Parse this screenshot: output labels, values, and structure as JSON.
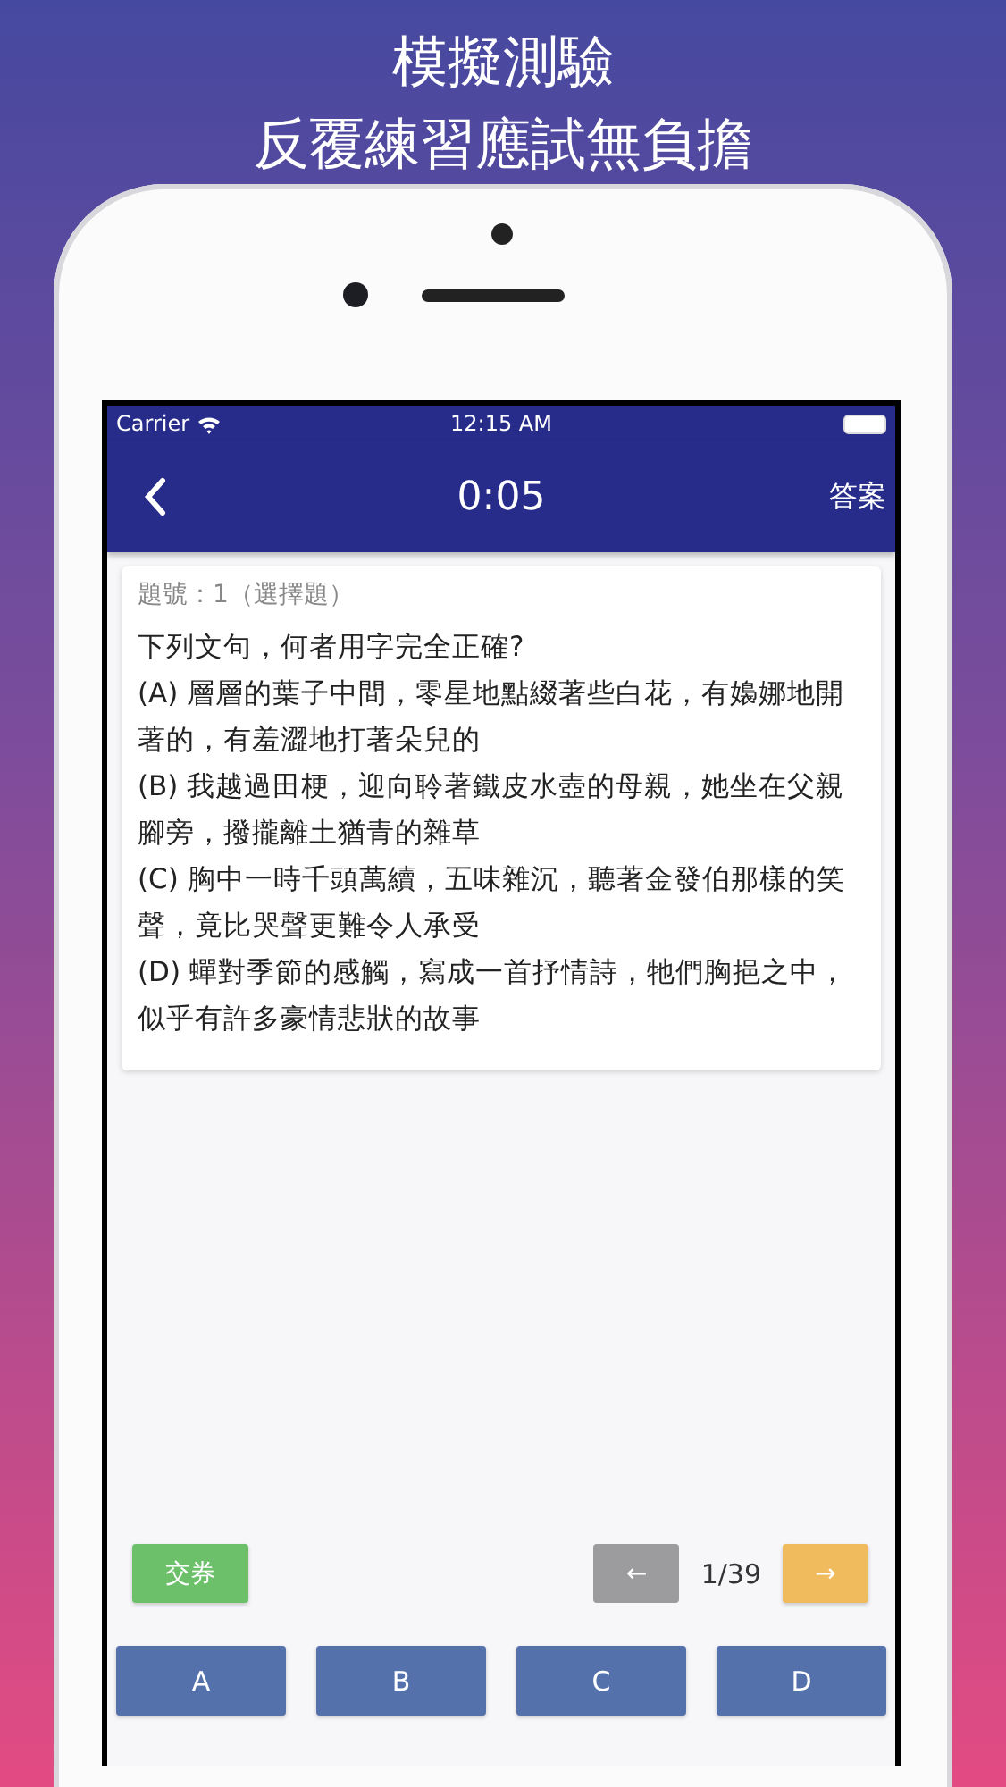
{
  "headline": [
    "模擬測驗",
    "反覆練習應試無負擔"
  ],
  "status_bar": {
    "carrier": "Carrier",
    "time": "12:15 AM"
  },
  "nav_bar": {
    "timer": "0:05",
    "action": "答案"
  },
  "question": {
    "number_label": "題號：1（選擇題）",
    "text": "下列文句，何者用字完全正確?",
    "options": [
      {
        "text": "(A) 層層的葉子中間，零星地點綴著些白花，有嬝娜地開著的，有羞澀地打著朵兒的"
      },
      {
        "text": "(B) 我越過田梗，迎向聆著鐵皮水壺的母親，她坐在父親腳旁，撥攏離土猶青的雜草"
      },
      {
        "text": "(C) 胸中一時千頭萬續，五味雜沉，聽著金發伯那樣的笑聲，竟比哭聲更難令人承受"
      },
      {
        "text": "(D) 蟬對季節的感觸，寫成一首抒情詩，牠們胸挹之中，似乎有許多豪情悲狀的故事"
      }
    ]
  },
  "submit_button": "交券",
  "pager": {
    "previous": {
      "label": "←",
      "disabled": true
    },
    "position": "1/39",
    "next": {
      "label": "→",
      "disabled": false
    }
  },
  "answer_buttons": [
    "A",
    "B",
    "C",
    "D"
  ]
}
